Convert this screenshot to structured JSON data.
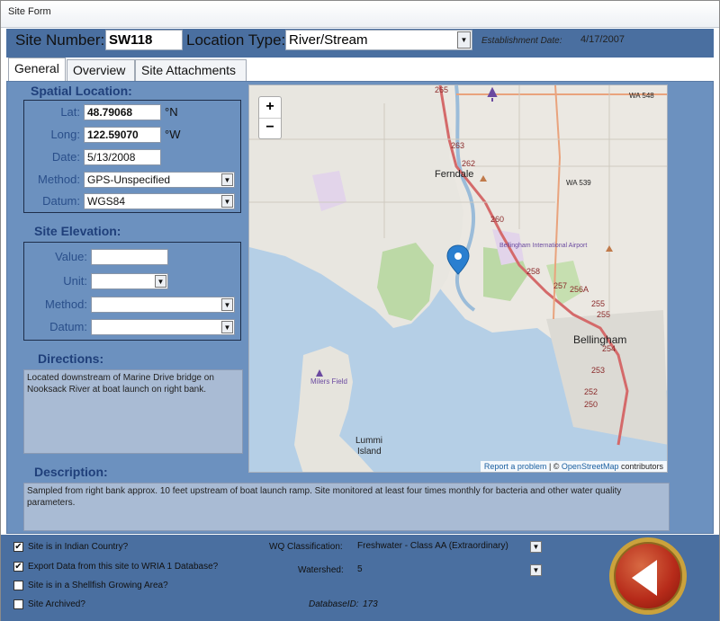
{
  "window": {
    "title": "Site Form"
  },
  "header": {
    "site_number_label": "Site Number:",
    "site_number": "SW118",
    "location_type_label": "Location Type:",
    "location_type": "River/Stream",
    "establishment_label": "Establishment Date:",
    "establishment_date": "4/17/2007"
  },
  "tabs": [
    "General",
    "Overview",
    "Site Attachments"
  ],
  "spatial": {
    "title": "Spatial Location:",
    "lat_label": "Lat:",
    "lat": "48.79068",
    "lat_unit": "°N",
    "long_label": "Long:",
    "long": "122.59070",
    "long_unit": "°W",
    "date_label": "Date:",
    "date": "5/13/2008",
    "method_label": "Method:",
    "method": "GPS-Unspecified",
    "datum_label": "Datum:",
    "datum": "WGS84"
  },
  "elevation": {
    "title": "Site Elevation:",
    "value_label": "Value:",
    "value": "",
    "unit_label": "Unit:",
    "unit": "",
    "method_label": "Method:",
    "method": "",
    "datum_label": "Datum:",
    "datum": ""
  },
  "directions": {
    "title": "Directions:",
    "text": "Located downstream of Marine Drive bridge on Nooksack River at boat launch on right bank."
  },
  "description": {
    "title": "Description:",
    "text": "Sampled from right bank approx. 10 feet upstream of boat launch ramp. Site monitored at least four times monthly for bacteria and other water quality parameters."
  },
  "map": {
    "zoom_in": "+",
    "zoom_out": "−",
    "attribution_link1": "Report a problem",
    "attribution_sep": " | © ",
    "attribution_link2": "OpenStreetMap",
    "attribution_tail": " contributors",
    "labels": {
      "ferndale": "Ferndale",
      "bellingham": "Bellingham",
      "lummi": "Lummi",
      "island": "Island",
      "milers": "Milers Field",
      "wa548": "WA 548",
      "wa539": "WA 539",
      "bia": "Bellingham International Airport",
      "r265": "265",
      "r263": "263",
      "r262": "262",
      "r260": "260",
      "r258": "258",
      "r257": "257",
      "r256a": "256A",
      "r255a": "255",
      "r255b": "255",
      "r254": "254",
      "r253": "253",
      "r252": "252",
      "r250": "250"
    }
  },
  "bottom": {
    "indian_country": {
      "label": "Site is in Indian Country?",
      "checked": true
    },
    "export_data": {
      "label": "Export Data from this site to WRIA 1 Database?",
      "checked": true
    },
    "shellfish": {
      "label": "Site is in a Shellfish Growing Area?",
      "checked": false
    },
    "archived": {
      "label": "Site Archived?",
      "checked": false
    },
    "wq_label": "WQ Classification:",
    "wq_value": "Freshwater - Class AA (Extraordinary)",
    "watershed_label": "Watershed:",
    "watershed_value": "5",
    "dbid_label": "DatabaseID:",
    "dbid_value": "173"
  },
  "colors": {
    "header": "#4a6fa0",
    "panel": "#6c91bf",
    "section_title": "#1f3f7a",
    "back_button": "#b72b1a"
  },
  "icons": {
    "back": "back-arrow-icon",
    "marker": "map-marker-icon",
    "airport": "airport-icon"
  }
}
